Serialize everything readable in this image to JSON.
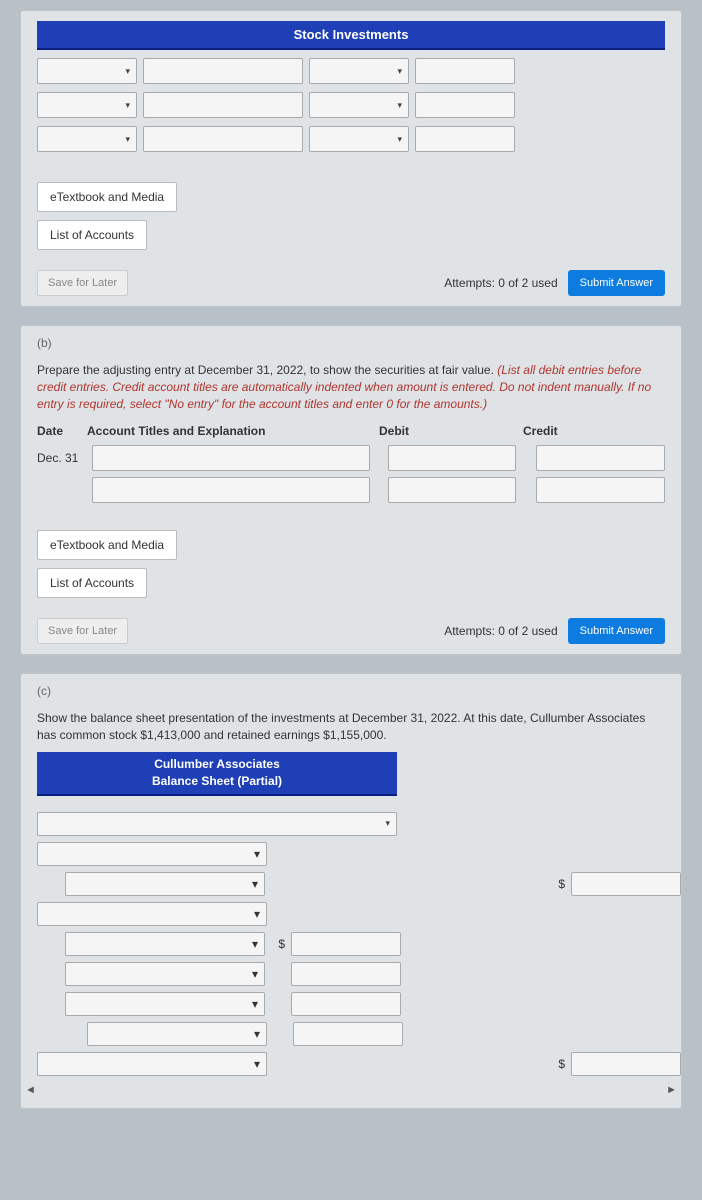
{
  "sectionA": {
    "header": "Stock Investments",
    "links": {
      "etext": "eTextbook and Media",
      "accounts": "List of Accounts"
    },
    "save_later": "Save for Later",
    "attempts": "Attempts: 0 of 2 used",
    "submit": "Submit Answer"
  },
  "sectionB": {
    "label": "(b)",
    "instruction_plain": "Prepare the adjusting entry at December 31, 2022, to show the securities at fair value. ",
    "instruction_ital": "(List all debit entries before credit entries. Credit account titles are automatically indented when amount is entered. Do not indent manually. If no entry is required, select \"No entry\" for the account titles and enter 0 for the amounts.)",
    "headers": {
      "date": "Date",
      "acct": "Account Titles and Explanation",
      "debit": "Debit",
      "credit": "Credit"
    },
    "date_value": "Dec. 31",
    "links": {
      "etext": "eTextbook and Media",
      "accounts": "List of Accounts"
    },
    "save_later": "Save for Later",
    "attempts": "Attempts: 0 of 2 used",
    "submit": "Submit Answer"
  },
  "sectionC": {
    "label": "(c)",
    "instruction": "Show the balance sheet presentation of the investments at December 31, 2022. At this date, Cullumber Associates has common stock $1,413,000 and retained earnings $1,155,000.",
    "bs_header_line1": "Cullumber Associates",
    "bs_header_line2": "Balance Sheet (Partial)",
    "currency": "$"
  },
  "icons": {
    "chevron": "▾",
    "scroll_left": "◄",
    "scroll_right": "►"
  }
}
